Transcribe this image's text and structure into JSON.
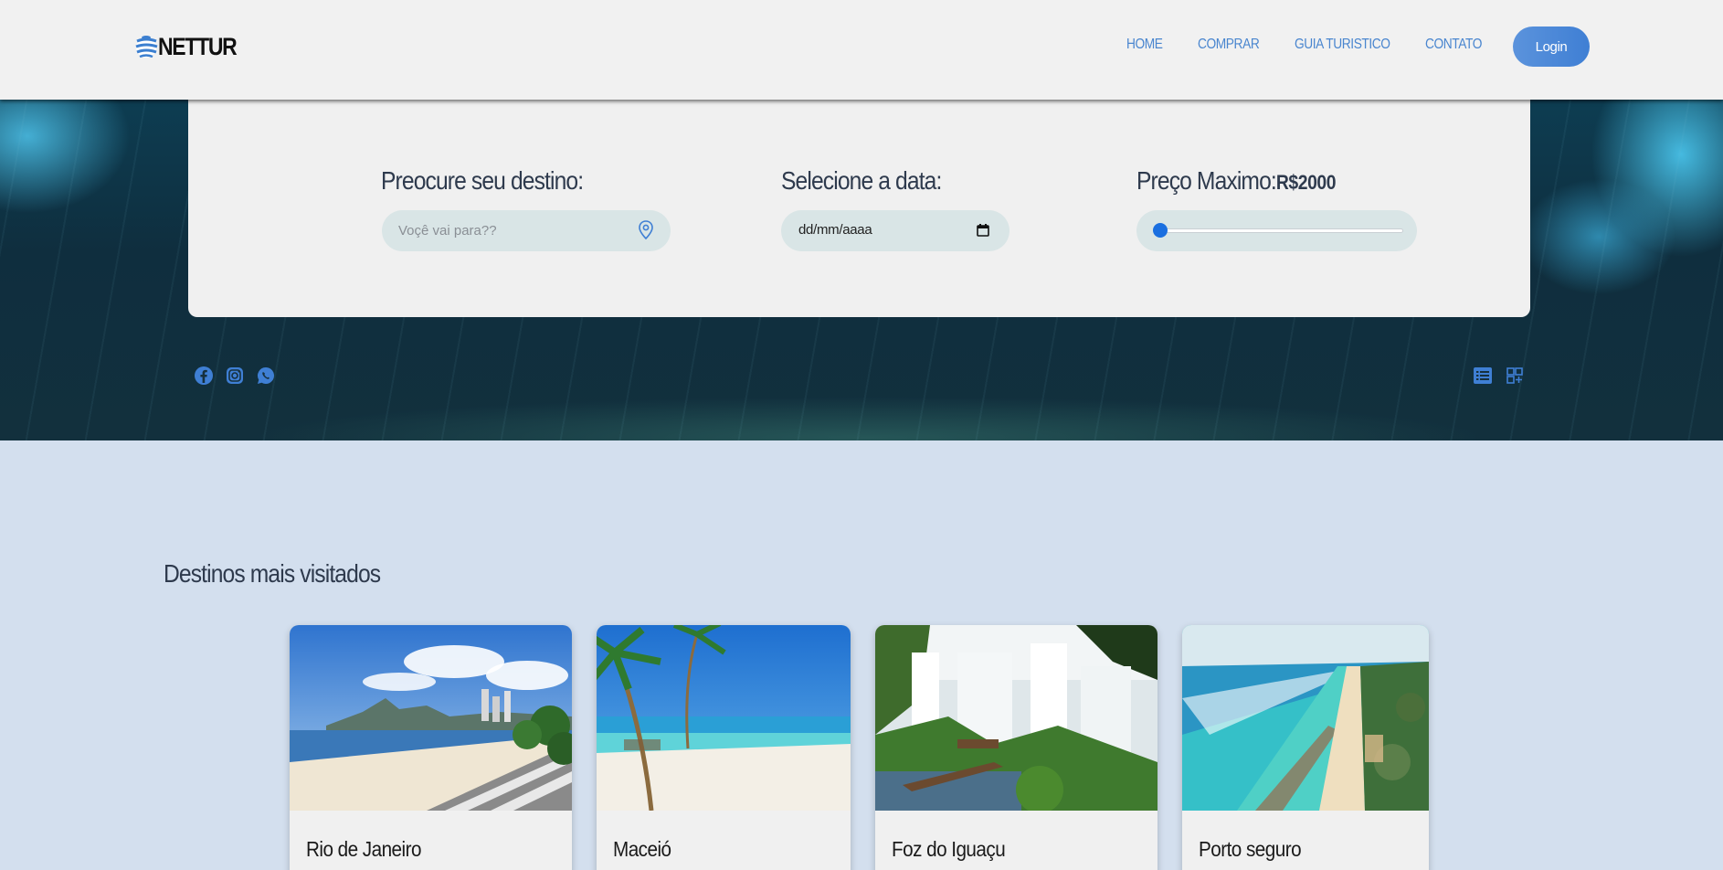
{
  "header": {
    "logo_text": "NETTUR",
    "nav": [
      "HOME",
      "COMPRAR",
      "GUIA TURISTICO",
      "CONTATO"
    ],
    "login_label": "Login"
  },
  "search": {
    "destination_label": "Preocure seu destino:",
    "destination_placeholder": "Voçê vai para??",
    "date_label": "Selecione a data:",
    "date_value": "dd/mm/aaaa",
    "price_label": "Preço Maximo:",
    "price_value": "R$2000",
    "price_slider_fraction": 0
  },
  "social_icons": [
    "facebook-icon",
    "instagram-icon",
    "whatsapp-icon"
  ],
  "view_toggle": [
    "list-view-icon",
    "grid-view-icon"
  ],
  "destinations": {
    "title": "Destinos mais visitados",
    "items": [
      {
        "name": "Rio de Janeiro"
      },
      {
        "name": "Maceió"
      },
      {
        "name": "Foz do Iguaçu"
      },
      {
        "name": "Porto seguro"
      }
    ]
  },
  "colors": {
    "accent": "#4a86cf",
    "login_gradient": "#5b93dc",
    "page_bg": "#d3dfee",
    "header_bg": "#f1f1f1",
    "card_bg": "#f0f0f0"
  }
}
